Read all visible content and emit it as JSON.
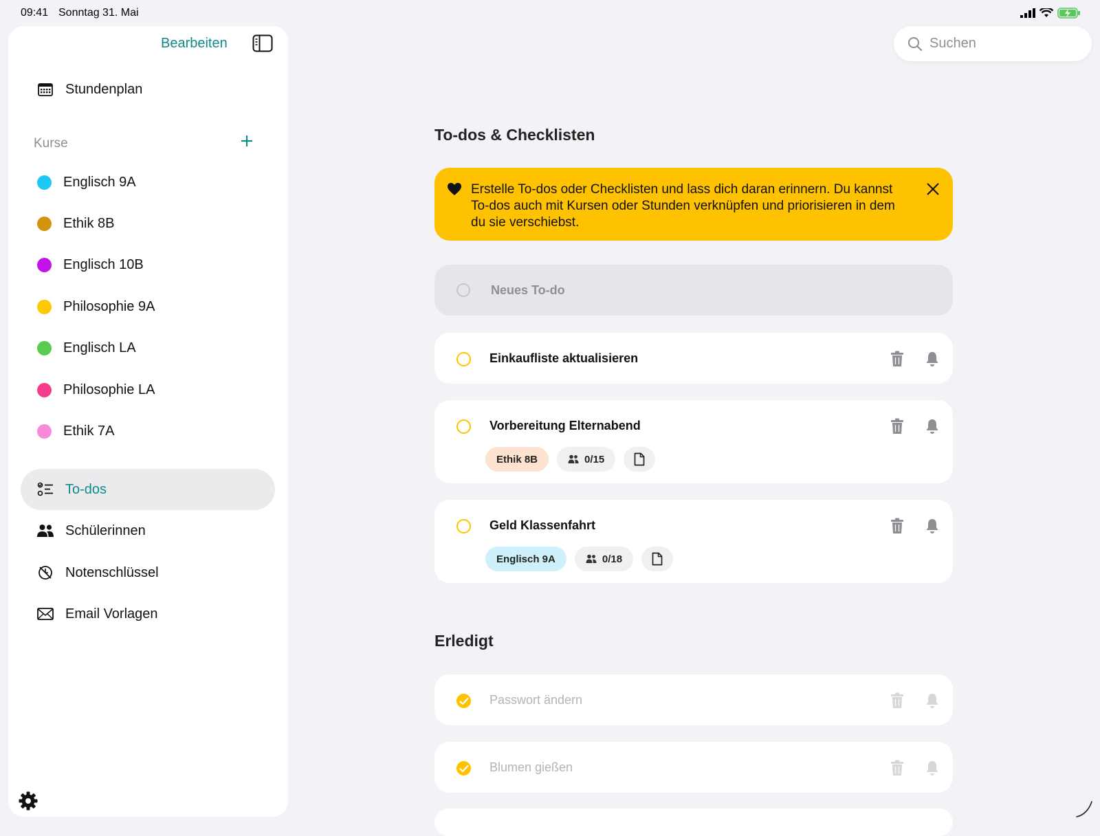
{
  "status_bar": {
    "time": "09:41",
    "date": "Sonntag 31. Mai",
    "icons": [
      "signal-icon",
      "wifi-icon",
      "battery-charging-icon"
    ]
  },
  "sidebar": {
    "edit_label": "Bearbeiten",
    "top_item": {
      "label": "Stundenplan",
      "icon": "calendar-icon"
    },
    "courses_title": "Kurse",
    "courses": [
      {
        "label": "Englisch 9A",
        "color": "#1ec8f5"
      },
      {
        "label": "Ethik 8B",
        "color": "#d4930f"
      },
      {
        "label": "Englisch 10B",
        "color": "#c114e8"
      },
      {
        "label": "Philosophie 9A",
        "color": "#ffc800"
      },
      {
        "label": "Englisch LA",
        "color": "#58cc4f"
      },
      {
        "label": "Philosophie LA",
        "color": "#f53c8c"
      },
      {
        "label": "Ethik 7A",
        "color": "#f78bd8"
      }
    ],
    "nav": [
      {
        "label": "To-dos",
        "icon": "checklist-icon",
        "active": true
      },
      {
        "label": "Schülerinnen",
        "icon": "people-icon"
      },
      {
        "label": "Notenschlüssel",
        "icon": "grade-key-icon"
      },
      {
        "label": "Email Vorlagen",
        "icon": "envelope-icon"
      }
    ]
  },
  "search": {
    "placeholder": "Suchen"
  },
  "main": {
    "todos_title": "To-dos & Checklisten",
    "banner_text": "Erstelle To-dos oder Checklisten und lass dich daran erinnern. Du kannst To-dos auch mit Kursen oder Stunden verknüpfen und priorisieren in dem du sie verschiebst.",
    "new_todo_placeholder": "Neues To-do",
    "open_todos": [
      {
        "title": "Einkaufliste aktualisieren"
      },
      {
        "title": "Vorbereitung Elternabend",
        "course": "Ethik 8B",
        "progress": "0/15"
      },
      {
        "title": "Geld Klassenfahrt",
        "course": "Englisch 9A",
        "progress": "0/18"
      }
    ],
    "done_title": "Erledigt",
    "done_todos": [
      {
        "title": "Passwort ändern"
      },
      {
        "title": "Blumen gießen"
      }
    ]
  },
  "colors": {
    "accent": "#0f8b87",
    "warning": "#ffc200",
    "background": "#f2f2f7"
  }
}
